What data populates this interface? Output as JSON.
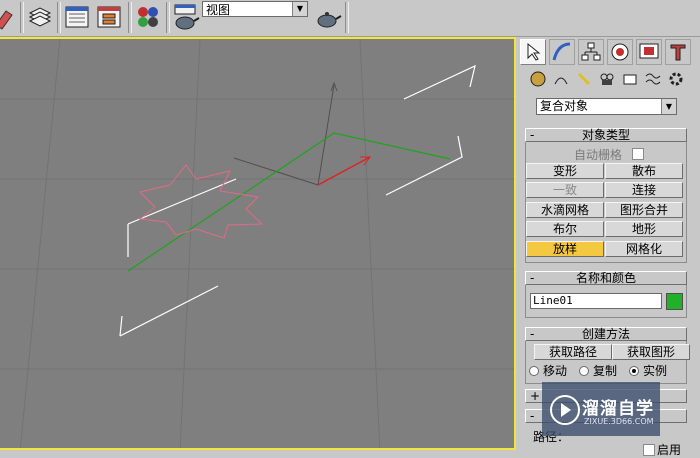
{
  "toolbar": {
    "view_dropdown": "视图",
    "icons": [
      "eraser-icon",
      "layers-icon",
      "track-view-icon",
      "schematic-view-icon",
      "material-editor-icon",
      "render-scene-icon",
      "quick-render-icon"
    ]
  },
  "command_panel": {
    "tabs": [
      "create-tab",
      "modify-tab",
      "hierarchy-tab",
      "motion-tab",
      "display-tab",
      "utilities-tab"
    ],
    "category_dropdown": "复合对象",
    "object_type": {
      "title": "对象类型",
      "auto_grid_label": "自动栅格",
      "buttons": [
        {
          "label": "变形",
          "state": "normal"
        },
        {
          "label": "散布",
          "state": "normal"
        },
        {
          "label": "一致",
          "state": "disabled"
        },
        {
          "label": "连接",
          "state": "normal"
        },
        {
          "label": "水滴网格",
          "state": "normal"
        },
        {
          "label": "图形合并",
          "state": "normal"
        },
        {
          "label": "布尔",
          "state": "normal"
        },
        {
          "label": "地形",
          "state": "normal"
        },
        {
          "label": "放样",
          "state": "active"
        },
        {
          "label": "网格化",
          "state": "normal"
        }
      ]
    },
    "name_color": {
      "title": "名称和颜色",
      "name": "Line01",
      "color": "#22b02a"
    },
    "creation_method": {
      "title": "创建方法",
      "get_path": "获取路径",
      "get_shape": "获取图形",
      "radios": [
        {
          "label": "移动",
          "checked": false
        },
        {
          "label": "复制",
          "checked": false
        },
        {
          "label": "实例",
          "checked": true
        }
      ]
    },
    "lower": {
      "path_label": "路径：",
      "use_label": "启用"
    },
    "rollout_minus": "-",
    "rollout_plus": "+"
  },
  "watermark": {
    "text": "溜溜自学",
    "url": "ZIXUE.3D66.COM"
  },
  "colors": {
    "viewport_bg": "#7f7f7f",
    "active_border": "#f2e63a",
    "active_button": "#f5c842",
    "spline_white": "#ffffff",
    "star_shape": "#e06a8a",
    "path_green": "#1fa31f",
    "axis_red": "#e02020"
  }
}
